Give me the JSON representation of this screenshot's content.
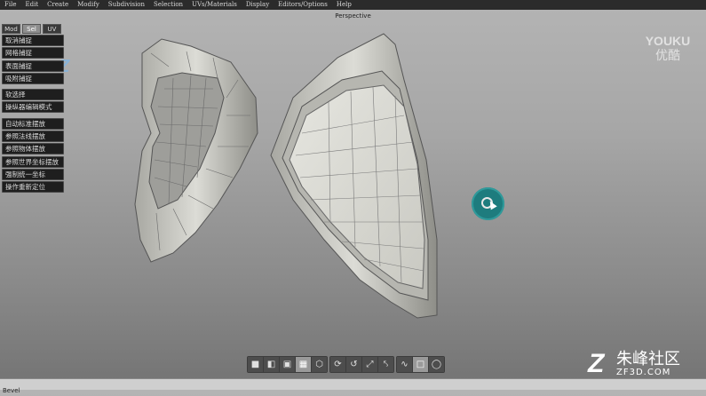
{
  "menubar": {
    "items": [
      "File",
      "Edit",
      "Create",
      "Modify",
      "Subdivision",
      "Selection",
      "UVs/Materials",
      "Display",
      "Editors/Options",
      "Help"
    ]
  },
  "viewport": {
    "label": "Perspective"
  },
  "tool_panel": {
    "tabs": [
      {
        "label": "Mod",
        "active": false
      },
      {
        "label": "Sel",
        "active": true
      },
      {
        "label": "UV",
        "active": false
      }
    ],
    "group1": [
      "取消捕捉",
      "网格捕捉",
      "表面捕捉",
      "吸附捕捉"
    ],
    "group2": [
      "软选择",
      "操纵器编辑模式"
    ],
    "group3": [
      "自动标准摆放",
      "参照法线摆放",
      "参照物体摆放",
      "参照世界坐标摆放",
      "强制统一坐标",
      "操作重新定位"
    ]
  },
  "bottom_toolbar": {
    "groups": [
      [
        "cube-front-icon",
        "cube-side-icon",
        "cube-shaded-icon",
        "cube-highlight-icon",
        "hexagon-icon"
      ],
      [
        "axis-move-icon",
        "axis-rotate-icon",
        "axis-scale-icon",
        "axis-universal-icon"
      ],
      [
        "curve-select-icon",
        "rect-select-icon",
        "lasso-select-icon"
      ]
    ],
    "active": [
      "cube-highlight-icon",
      "rect-select-icon"
    ]
  },
  "status_bar": {
    "text": "Bevel"
  },
  "watermarks": {
    "youku_en": "YOUKU",
    "youku_cn": "优酷",
    "zf_cn": "朱峰社区",
    "zf_en": "ZF3D.COM"
  }
}
